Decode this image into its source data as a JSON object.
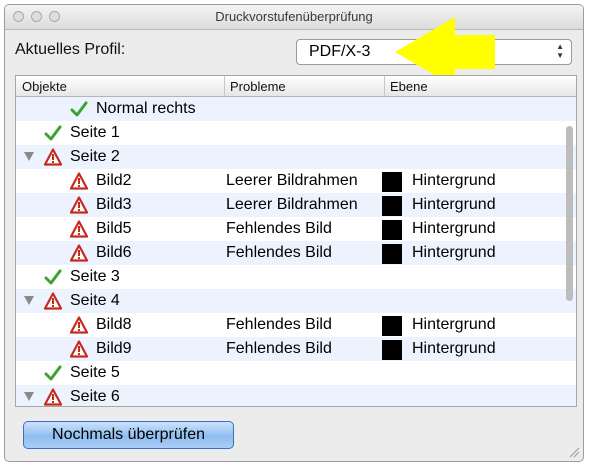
{
  "window": {
    "title": "Druckvorstufenüberprüfung"
  },
  "profile": {
    "label": "Aktuelles Profil:",
    "value": "PDF/X-3"
  },
  "columns": [
    "Objekte",
    "Probleme",
    "Ebene"
  ],
  "rows": [
    {
      "object": "Normal rechts",
      "problem": "",
      "layer": "",
      "icon": "check-icon",
      "level": 2,
      "expand": ""
    },
    {
      "object": "Seite 1",
      "problem": "",
      "layer": "",
      "icon": "check-icon",
      "level": 1,
      "expand": ""
    },
    {
      "object": "Seite 2",
      "problem": "",
      "layer": "",
      "icon": "warning-icon",
      "level": 1,
      "expand": "expanded"
    },
    {
      "object": "Bild2",
      "problem": "Leerer Bildrahmen",
      "layer": "Hintergrund",
      "icon": "warning-icon",
      "level": 2,
      "expand": ""
    },
    {
      "object": "Bild3",
      "problem": "Leerer Bildrahmen",
      "layer": "Hintergrund",
      "icon": "warning-icon",
      "level": 2,
      "expand": ""
    },
    {
      "object": "Bild5",
      "problem": "Fehlendes Bild",
      "layer": "Hintergrund",
      "icon": "warning-icon",
      "level": 2,
      "expand": ""
    },
    {
      "object": "Bild6",
      "problem": "Fehlendes Bild",
      "layer": "Hintergrund",
      "icon": "warning-icon",
      "level": 2,
      "expand": ""
    },
    {
      "object": "Seite 3",
      "problem": "",
      "layer": "",
      "icon": "check-icon",
      "level": 1,
      "expand": ""
    },
    {
      "object": "Seite 4",
      "problem": "",
      "layer": "",
      "icon": "warning-icon",
      "level": 1,
      "expand": "expanded"
    },
    {
      "object": "Bild8",
      "problem": "Fehlendes Bild",
      "layer": "Hintergrund",
      "icon": "warning-icon",
      "level": 2,
      "expand": ""
    },
    {
      "object": "Bild9",
      "problem": "Fehlendes Bild",
      "layer": "Hintergrund",
      "icon": "warning-icon",
      "level": 2,
      "expand": ""
    },
    {
      "object": "Seite 5",
      "problem": "",
      "layer": "",
      "icon": "check-icon",
      "level": 1,
      "expand": ""
    },
    {
      "object": "Seite 6",
      "problem": "",
      "layer": "",
      "icon": "warning-icon",
      "level": 1,
      "expand": "expanded"
    }
  ],
  "button": {
    "label": "Nochmals überprüfen"
  },
  "colors": {
    "check": "#3ba32e",
    "warning": "#c62b1c",
    "alt_row": "#edf3fe",
    "annotation_arrow": "#ffff00"
  }
}
